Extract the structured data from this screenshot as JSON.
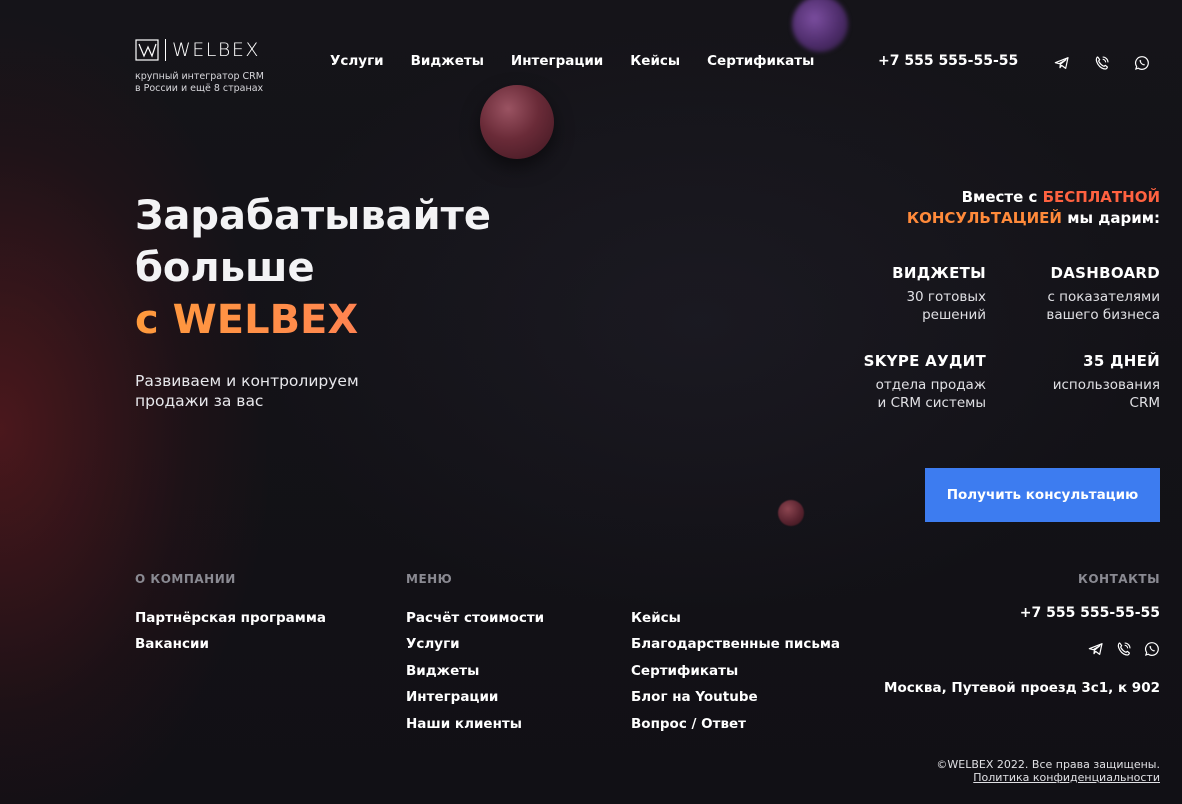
{
  "brand": {
    "name": "WELBEX",
    "tagline_line1": "крупный интегратор CRM",
    "tagline_line2": "в России и ещё 8 странах"
  },
  "nav": {
    "items": [
      {
        "label": "Услуги"
      },
      {
        "label": "Виджеты"
      },
      {
        "label": "Интеграции"
      },
      {
        "label": "Кейсы"
      },
      {
        "label": "Сертификаты"
      }
    ]
  },
  "header": {
    "phone": "+7 555 555-55-55",
    "icons": [
      "telegram-icon",
      "viber-icon",
      "whatsapp-icon"
    ]
  },
  "hero": {
    "title_line1": "Зарабатывайте",
    "title_line2": "больше",
    "title_accent": "с WELBEX",
    "subtitle_line1": "Развиваем и контролируем",
    "subtitle_line2": "продажи за вас"
  },
  "offer": {
    "head_part1": "Вместе с ",
    "head_hl1": "БЕСПЛАТНОЙ",
    "head_hl2": "КОНСУЛЬТАЦИЕЙ",
    "head_part2": " мы дарим:",
    "features": [
      {
        "title": "ВИДЖЕТЫ",
        "desc1": "30 готовых",
        "desc2": "решений"
      },
      {
        "title": "DASHBOARD",
        "desc1": "с показателями",
        "desc2": "вашего бизнеса"
      },
      {
        "title": "SKYPE АУДИТ",
        "desc1": "отдела продаж",
        "desc2": "и CRM системы"
      },
      {
        "title": "35 ДНЕЙ",
        "desc1": "использования",
        "desc2": "CRM"
      }
    ],
    "cta_label": "Получить консультацию"
  },
  "footer": {
    "company_heading": "О КОМПАНИИ",
    "company_links": [
      {
        "label": "Партнёрская программа"
      },
      {
        "label": "Вакансии"
      }
    ],
    "menu_heading": "МЕНЮ",
    "menu_col1": [
      {
        "label": "Расчёт стоимости"
      },
      {
        "label": "Услуги"
      },
      {
        "label": "Виджеты"
      },
      {
        "label": "Интеграции"
      },
      {
        "label": "Наши клиенты"
      }
    ],
    "menu_col2": [
      {
        "label": "Кейсы"
      },
      {
        "label": "Благодарственные письма"
      },
      {
        "label": "Сертификаты"
      },
      {
        "label": "Блог на Youtube"
      },
      {
        "label": "Вопрос / Ответ"
      }
    ],
    "contacts_heading": "КОНТАКТЫ",
    "phone": "+7 555 555-55-55",
    "address": "Москва, Путевой проезд 3с1, к 902",
    "copyright": "©WELBEX 2022. Все права защищены.",
    "policy": "Политика конфиденциальности"
  },
  "colors": {
    "accent_orange": "#ff8a3a",
    "accent_red": "#ff6240",
    "cta_blue": "#3d7cf0",
    "background": "#111015"
  }
}
